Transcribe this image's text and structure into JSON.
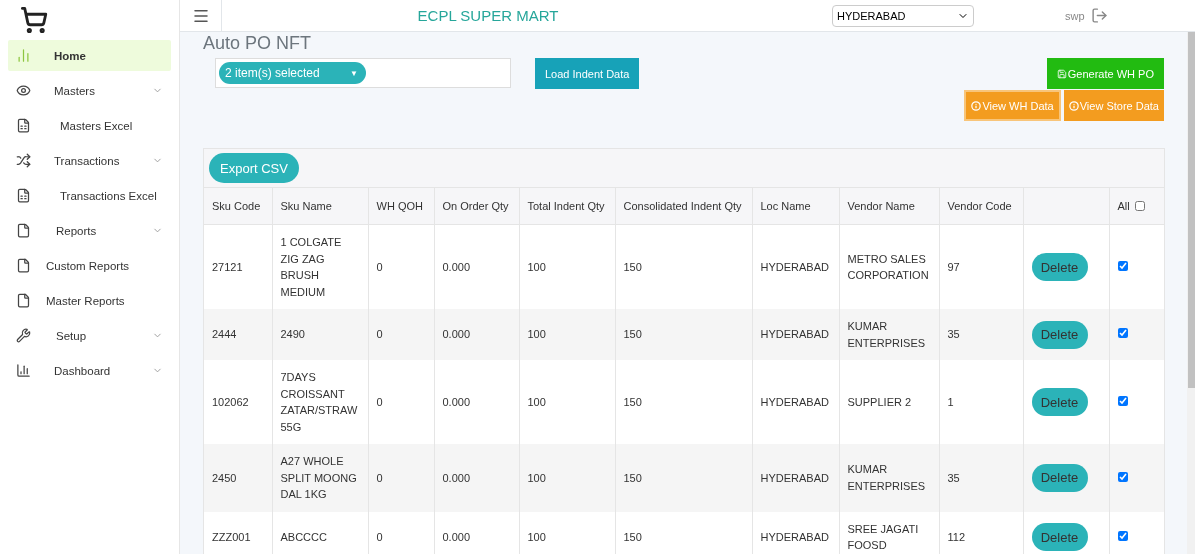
{
  "sidebar": {
    "items": [
      {
        "label": "Home",
        "selected": true,
        "expandable": false
      },
      {
        "label": "Masters",
        "selected": false,
        "expandable": true
      },
      {
        "label": "Masters Excel",
        "selected": false,
        "expandable": false
      },
      {
        "label": "Transactions",
        "selected": false,
        "expandable": true
      },
      {
        "label": "Transactions Excel",
        "selected": false,
        "expandable": false
      },
      {
        "label": "Reports",
        "selected": false,
        "expandable": true
      },
      {
        "label": "Custom Reports",
        "selected": false,
        "expandable": false
      },
      {
        "label": "Master Reports",
        "selected": false,
        "expandable": false
      },
      {
        "label": "Setup",
        "selected": false,
        "expandable": true
      },
      {
        "label": "Dashboard",
        "selected": false,
        "expandable": true
      }
    ]
  },
  "topbar": {
    "title": "ECPL SUPER MART",
    "location": "HYDERABAD",
    "user": "swp"
  },
  "page_title": "Auto PO NFT",
  "multi_select": {
    "value": "2 item(s) selected",
    "caret": "▼"
  },
  "buttons": {
    "load": "Load Indent Data",
    "generate": "Generate WH PO",
    "view_wh": "View WH Data",
    "view_store": "View Store Data",
    "export": "Export CSV"
  },
  "table": {
    "columns": [
      "Sku Code",
      "Sku Name",
      "WH QOH",
      "On Order Qty",
      "Total Indent Qty",
      "Consolidated Indent Qty",
      "Loc Name",
      "Vendor Name",
      "Vendor Code",
      "",
      "All"
    ],
    "select_all": false,
    "rows": [
      {
        "sku_code": "27121",
        "sku_name": "1 COLGATE ZIG ZAG BRUSH MEDIUM",
        "wh_qoh": "0",
        "on_order": "0.000",
        "total_indent": "100",
        "consolidated": "150",
        "loc": "HYDERABAD",
        "vendor_name": "METRO SALES CORPORATION",
        "vendor_code": "97",
        "action": "Delete",
        "checked": true
      },
      {
        "sku_code": "2444",
        "sku_name": "2490",
        "wh_qoh": "0",
        "on_order": "0.000",
        "total_indent": "100",
        "consolidated": "150",
        "loc": "HYDERABAD",
        "vendor_name": "KUMAR ENTERPRISES",
        "vendor_code": "35",
        "action": "Delete",
        "checked": true
      },
      {
        "sku_code": "102062",
        "sku_name": "7DAYS CROISSANT ZATAR/STRAW 55G",
        "wh_qoh": "0",
        "on_order": "0.000",
        "total_indent": "100",
        "consolidated": "150",
        "loc": "HYDERABAD",
        "vendor_name": "SUPPLIER 2",
        "vendor_code": "1",
        "action": "Delete",
        "checked": true
      },
      {
        "sku_code": "2450",
        "sku_name": "A27 WHOLE SPLIT MOONG DAL 1KG",
        "wh_qoh": "0",
        "on_order": "0.000",
        "total_indent": "100",
        "consolidated": "150",
        "loc": "HYDERABAD",
        "vendor_name": "KUMAR ENTERPRISES",
        "vendor_code": "35",
        "action": "Delete",
        "checked": true
      },
      {
        "sku_code": "ZZZ001",
        "sku_name": "ABCCCC",
        "wh_qoh": "0",
        "on_order": "0.000",
        "total_indent": "100",
        "consolidated": "150",
        "loc": "HYDERABAD",
        "vendor_name": "SREE JAGATI FOOSD",
        "vendor_code": "112",
        "action": "Delete",
        "checked": true
      }
    ]
  }
}
